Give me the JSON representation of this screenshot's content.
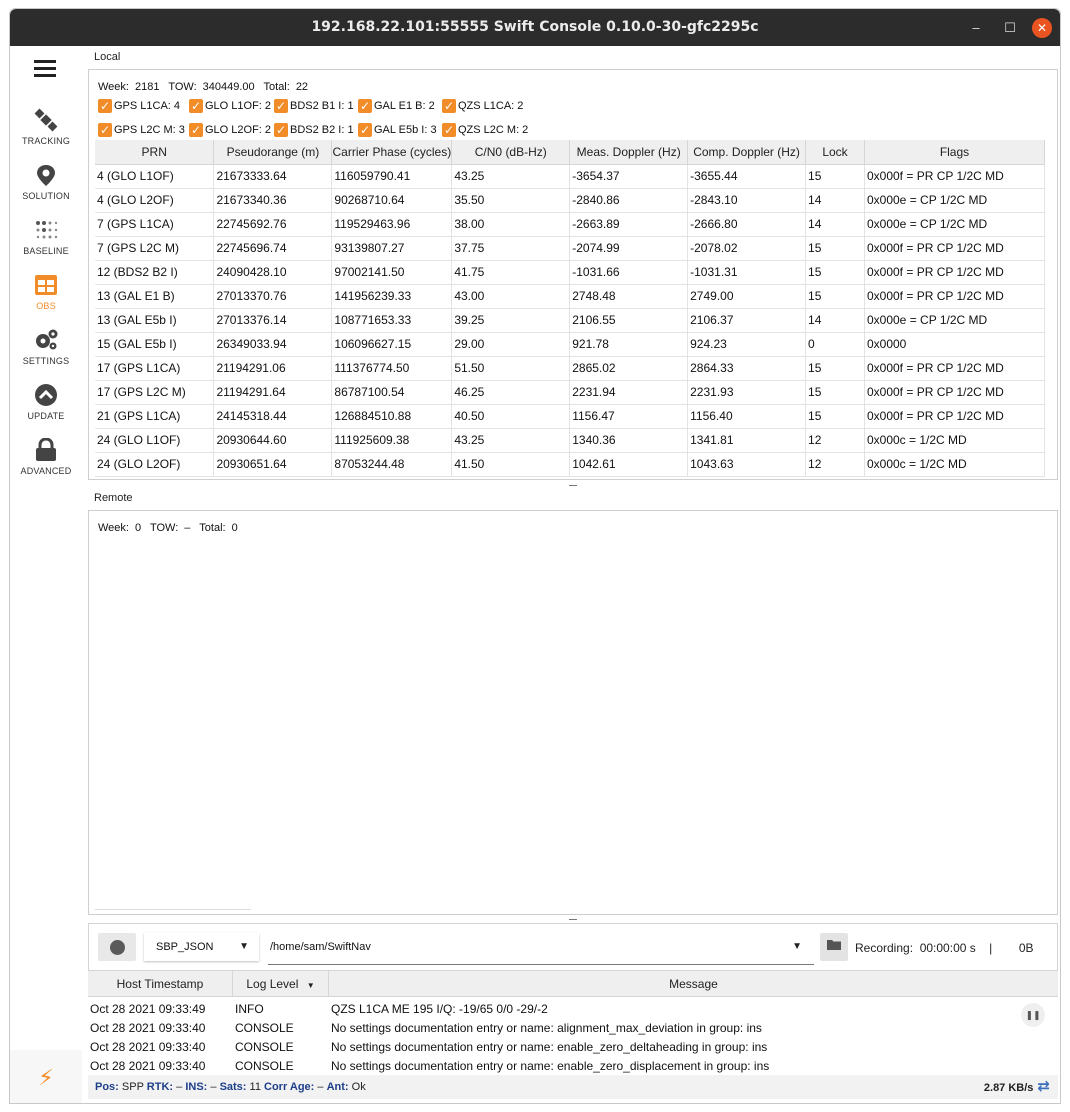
{
  "window": {
    "title": "192.168.22.101:55555 Swift Console 0.10.0-30-gfc2295c",
    "minimize": "–",
    "maximize": "☐",
    "close": "✕"
  },
  "sidebar": {
    "items": [
      {
        "label": "TRACKING",
        "icon": "satellite-icon"
      },
      {
        "label": "SOLUTION",
        "icon": "location-pin-icon"
      },
      {
        "label": "BASELINE",
        "icon": "dots-grid-icon"
      },
      {
        "label": "OBS",
        "icon": "table-icon",
        "active": true
      },
      {
        "label": "SETTINGS",
        "icon": "gears-icon"
      },
      {
        "label": "UPDATE",
        "icon": "chevron-up-circle-icon"
      },
      {
        "label": "ADVANCED",
        "icon": "lock-icon"
      }
    ],
    "accent": "#f28c28"
  },
  "local": {
    "label": "Local",
    "week_label": "Week:",
    "week": "2181",
    "tow_label": "TOW:",
    "tow": "340449.00",
    "total_label": "Total:",
    "total": "22",
    "filters_row1": [
      "GPS L1CA: 4",
      "GLO L1OF: 2",
      "BDS2 B1 I: 1",
      "GAL E1 B: 2",
      "QZS L1CA: 2"
    ],
    "filters_row2": [
      "GPS L2C M: 3",
      "GLO L2OF: 2",
      "BDS2 B2 I: 1",
      "GAL E5b I: 3",
      "QZS L2C M: 2"
    ],
    "columns": [
      "PRN",
      "Pseudorange (m)",
      "Carrier Phase (cycles)",
      "C/N0 (dB-Hz)",
      "Meas. Doppler (Hz)",
      "Comp. Doppler (Hz)",
      "Lock",
      "Flags"
    ],
    "rows": [
      [
        "4 (GLO L1OF)",
        "21673333.64",
        "116059790.41",
        "43.25",
        "-3654.37",
        "-3655.44",
        "15",
        "0x000f = PR CP 1/2C MD"
      ],
      [
        "4 (GLO L2OF)",
        "21673340.36",
        "90268710.64",
        "35.50",
        "-2840.86",
        "-2843.10",
        "14",
        "0x000e = CP 1/2C MD"
      ],
      [
        "7 (GPS L1CA)",
        "22745692.76",
        "119529463.96",
        "38.00",
        "-2663.89",
        "-2666.80",
        "14",
        "0x000e = CP 1/2C MD"
      ],
      [
        "7 (GPS L2C M)",
        "22745696.74",
        "93139807.27",
        "37.75",
        "-2074.99",
        "-2078.02",
        "15",
        "0x000f = PR CP 1/2C MD"
      ],
      [
        "12 (BDS2 B2 I)",
        "24090428.10",
        "97002141.50",
        "41.75",
        "-1031.66",
        "-1031.31",
        "15",
        "0x000f = PR CP 1/2C MD"
      ],
      [
        "13 (GAL E1 B)",
        "27013370.76",
        "141956239.33",
        "43.00",
        "2748.48",
        "2749.00",
        "15",
        "0x000f = PR CP 1/2C MD"
      ],
      [
        "13 (GAL E5b I)",
        "27013376.14",
        "108771653.33",
        "39.25",
        "2106.55",
        "2106.37",
        "14",
        "0x000e = CP 1/2C MD"
      ],
      [
        "15 (GAL E5b I)",
        "26349033.94",
        "106096627.15",
        "29.00",
        "921.78",
        "924.23",
        "0",
        "0x0000"
      ],
      [
        "17 (GPS L1CA)",
        "21194291.06",
        "111376774.50",
        "51.50",
        "2865.02",
        "2864.33",
        "15",
        "0x000f = PR CP 1/2C MD"
      ],
      [
        "17 (GPS L2C M)",
        "21194291.64",
        "86787100.54",
        "46.25",
        "2231.94",
        "2231.93",
        "15",
        "0x000f = PR CP 1/2C MD"
      ],
      [
        "21 (GPS L1CA)",
        "24145318.44",
        "126884510.88",
        "40.50",
        "1156.47",
        "1156.40",
        "15",
        "0x000f = PR CP 1/2C MD"
      ],
      [
        "24 (GLO L1OF)",
        "20930644.60",
        "111925609.38",
        "43.25",
        "1340.36",
        "1341.81",
        "12",
        "0x000c = 1/2C MD"
      ],
      [
        "24 (GLO L2OF)",
        "20930651.64",
        "87053244.48",
        "41.50",
        "1042.61",
        "1043.63",
        "12",
        "0x000c = 1/2C MD"
      ]
    ]
  },
  "remote": {
    "label": "Remote",
    "week_label": "Week:",
    "week": "0",
    "tow_label": "TOW:",
    "tow": "–",
    "total_label": "Total:",
    "total": "0"
  },
  "logging": {
    "format": "SBP_JSON",
    "path": "/home/sam/SwiftNav",
    "recording_text": "Recording:  00:00:00 s    |        0B"
  },
  "log": {
    "columns": [
      "Host Timestamp",
      "Log Level",
      "Message"
    ],
    "rows": [
      [
        "Oct 28 2021 09:33:49",
        "INFO",
        "QZS L1CA ME 195 I/Q: -19/65 0/0 -29/-2"
      ],
      [
        "Oct 28 2021 09:33:40",
        "CONSOLE",
        "No settings documentation entry or name: alignment_max_deviation in group: ins"
      ],
      [
        "Oct 28 2021 09:33:40",
        "CONSOLE",
        "No settings documentation entry or name: enable_zero_deltaheading in group: ins"
      ],
      [
        "Oct 28 2021 09:33:40",
        "CONSOLE",
        "No settings documentation entry or name: enable_zero_displacement in group: ins"
      ]
    ]
  },
  "status": {
    "pos_label": "Pos:",
    "pos": "SPP",
    "rtk_label": "RTK:",
    "rtk": "–",
    "ins_label": "INS:",
    "ins": "–",
    "sats_label": "Sats:",
    "sats": "11",
    "corr_label": "Corr Age:",
    "corr": "–",
    "ant_label": "Ant:",
    "ant": "Ok",
    "rate": "2.87 KB/s"
  }
}
